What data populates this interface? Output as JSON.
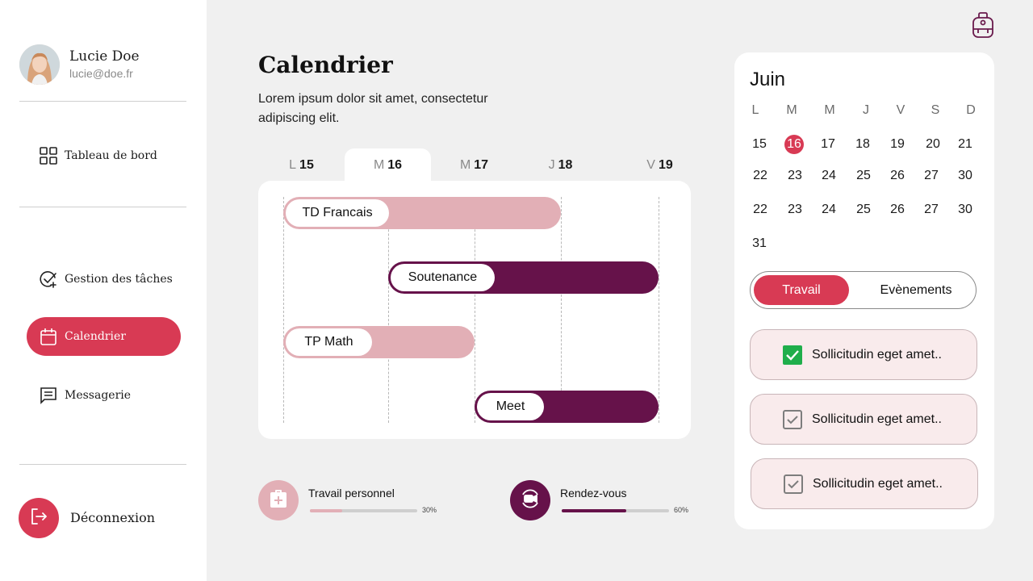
{
  "user": {
    "name": "Lucie Doe",
    "email": "lucie@doe.fr"
  },
  "nav": {
    "dashboard": "Tableau de bord",
    "tasks": "Gestion des tâches",
    "calendar": "Calendrier",
    "messages": "Messagerie",
    "logout": "Déconnexion"
  },
  "main": {
    "title": "Calendrier",
    "description": "Lorem ipsum dolor sit amet, consectetur adipiscing elit."
  },
  "day_tabs": [
    {
      "letter": "L",
      "num": "15",
      "active": false
    },
    {
      "letter": "M",
      "num": "16",
      "active": true
    },
    {
      "letter": "M",
      "num": "17",
      "active": false
    },
    {
      "letter": "J",
      "num": "18",
      "active": false
    },
    {
      "letter": "V",
      "num": "19",
      "active": false
    }
  ],
  "events": [
    {
      "label": "TD Francais",
      "start_day": "15",
      "end_day": "18",
      "color": "#e2afb6"
    },
    {
      "label": "Soutenance",
      "start_day": "16",
      "end_day": "19",
      "color": "#66124a"
    },
    {
      "label": "TP Math",
      "start_day": "15",
      "end_day": "17",
      "color": "#e2afb6"
    },
    {
      "label": "Meet",
      "start_day": "17",
      "end_day": "19",
      "color": "#66124a"
    }
  ],
  "stats": [
    {
      "label": "Travail personnel",
      "percent": "30%",
      "value": 0.3,
      "color": "#e2afb6",
      "icon": "medkit-icon"
    },
    {
      "label": "Rendez-vous",
      "percent": "60%",
      "value": 0.6,
      "color": "#66124a",
      "icon": "video-call-icon"
    }
  ],
  "calendar": {
    "month": "Juin",
    "weekdays": [
      "L",
      "M",
      "M",
      "J",
      "V",
      "S",
      "D"
    ],
    "rows": [
      [
        "15",
        "16",
        "17",
        "18",
        "19",
        "20",
        "21"
      ],
      [
        "22",
        "23",
        "24",
        "25",
        "26",
        "27",
        "30"
      ],
      [
        "22",
        "23",
        "24",
        "25",
        "26",
        "27",
        "30"
      ],
      [
        "31"
      ]
    ],
    "today": "16"
  },
  "toggle": {
    "work": "Travail",
    "events": "Evènements"
  },
  "tasks": [
    {
      "text": "Sollicitudin eget amet..",
      "checked": true
    },
    {
      "text": "Sollicitudin eget amet..",
      "checked": false
    },
    {
      "text": "Sollicitudin eget amet..",
      "checked": false
    }
  ],
  "colors": {
    "accent": "#d83a54",
    "plum": "#66124a",
    "pink": "#e2afb6",
    "check_green": "#1fae4b"
  }
}
